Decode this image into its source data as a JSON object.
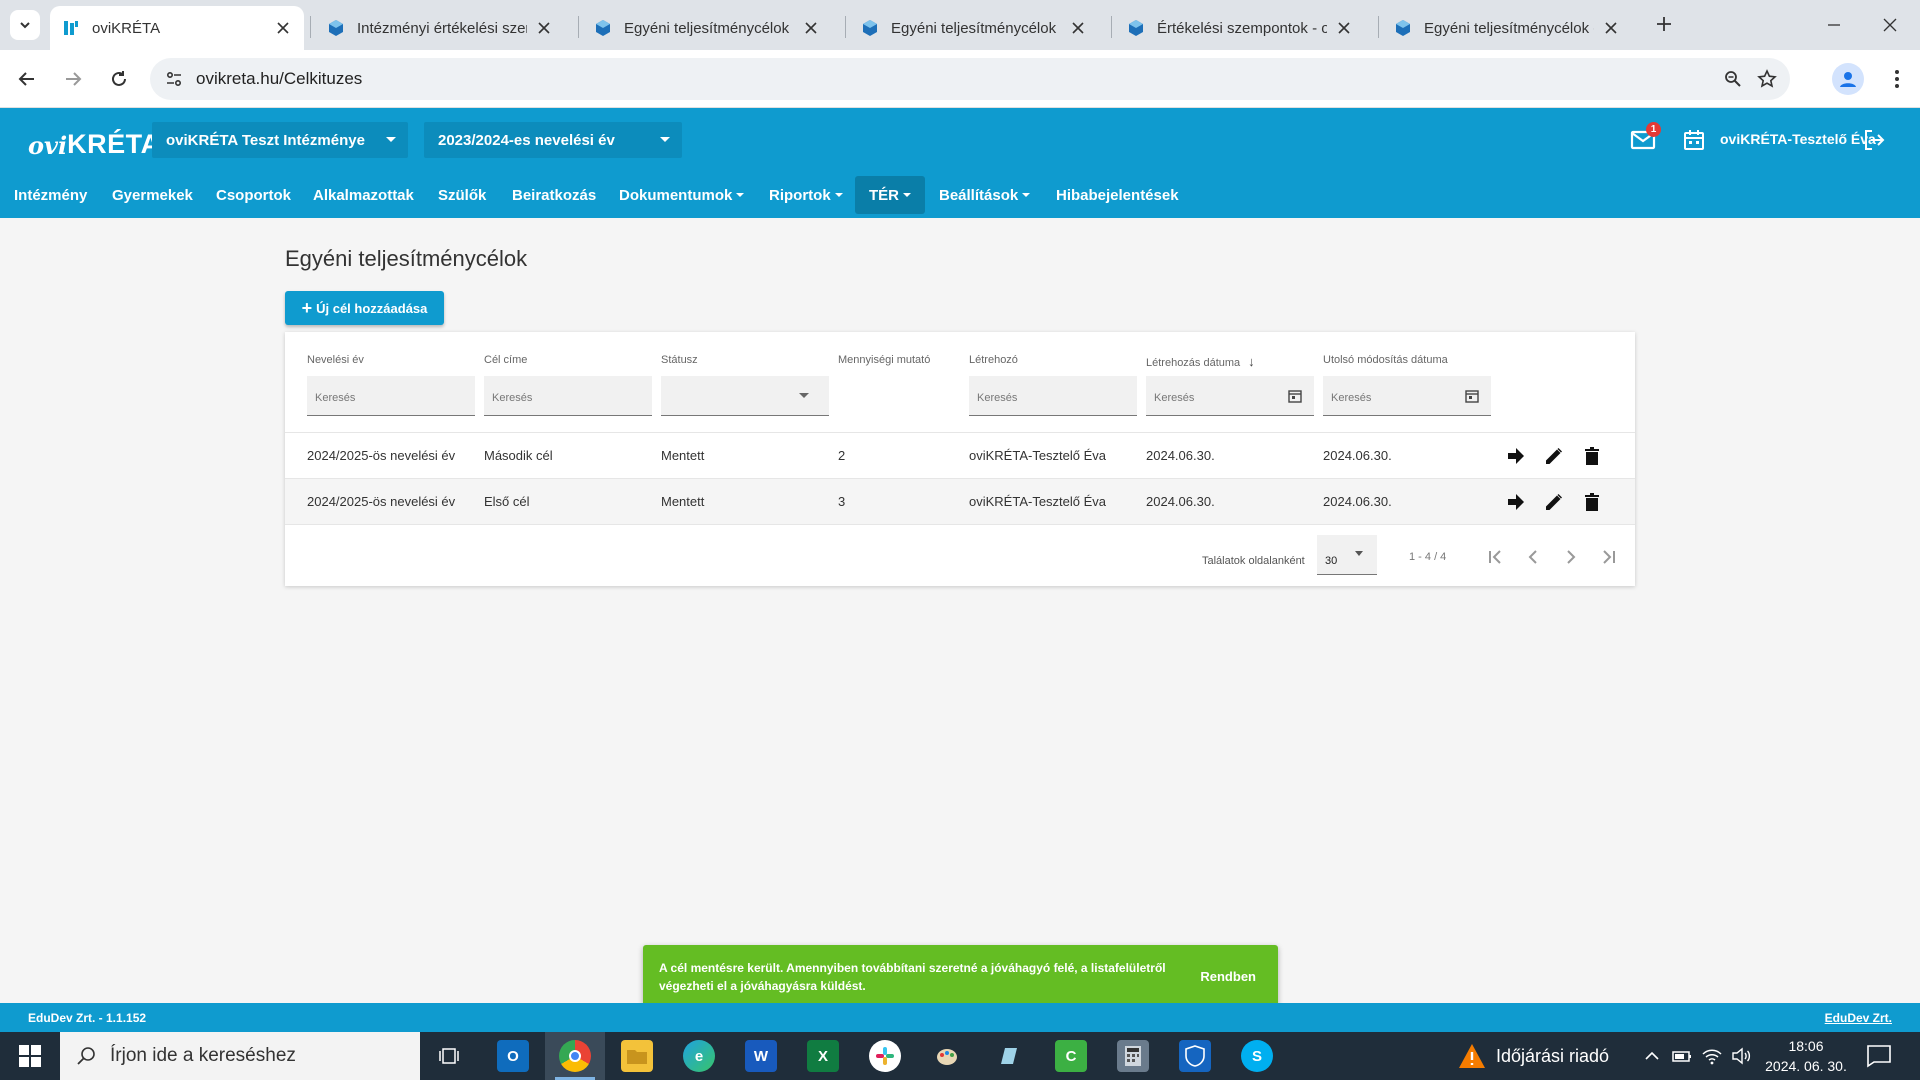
{
  "browser": {
    "tabs": [
      {
        "title": "oviKRÉTA",
        "active": true
      },
      {
        "title": "Intézményi értékelési szem",
        "active": false
      },
      {
        "title": "Egyéni teljesítménycélok r",
        "active": false
      },
      {
        "title": "Egyéni teljesítménycélok r",
        "active": false
      },
      {
        "title": "Értékelési szempontok - ov",
        "active": false
      },
      {
        "title": "Egyéni teljesítménycélok -",
        "active": false
      }
    ],
    "url": "ovikreta.hu/Celkituzes"
  },
  "header": {
    "logo_prefix": "ovi",
    "logo_main": "KRÉTA",
    "institution": "oviKRÉTA Teszt Intézménye",
    "school_year": "2023/2024-es nevelési év",
    "mail_badge": "1",
    "user": "oviKRÉTA-Tesztelő Éva"
  },
  "nav": [
    {
      "label": "Intézmény",
      "dropdown": false
    },
    {
      "label": "Gyermekek",
      "dropdown": false
    },
    {
      "label": "Csoportok",
      "dropdown": false
    },
    {
      "label": "Alkalmazottak",
      "dropdown": false
    },
    {
      "label": "Szülők",
      "dropdown": false
    },
    {
      "label": "Beiratkozás",
      "dropdown": false
    },
    {
      "label": "Dokumentumok",
      "dropdown": true
    },
    {
      "label": "Riportok",
      "dropdown": true
    },
    {
      "label": "TÉR",
      "dropdown": true
    },
    {
      "label": "Beállítások",
      "dropdown": true
    },
    {
      "label": "Hibabejelentések",
      "dropdown": false
    }
  ],
  "page": {
    "title": "Egyéni teljesítménycélok",
    "add_button": "Új cél hozzáadása"
  },
  "grid": {
    "columns": [
      "Nevelési év",
      "Cél címe",
      "Státusz",
      "Mennyiségi mutató",
      "Létrehozó",
      "Létrehozás dátuma",
      "Utolsó módosítás dátuma"
    ],
    "filter_placeholder": "Keresés",
    "rows": [
      [
        "2024/2025-ös nevelési év",
        "Második cél",
        "Mentett",
        "2",
        "oviKRÉTA-Tesztelő Éva",
        "2024.06.30.",
        "2024.06.30."
      ],
      [
        "2024/2025-ös nevelési év",
        "Első cél",
        "Mentett",
        "3",
        "oviKRÉTA-Tesztelő Éva",
        "2024.06.30.",
        "2024.06.30."
      ]
    ],
    "per_page_label": "Találatok oldalanként",
    "per_page": "30",
    "range": "1 - 4 / 4"
  },
  "footer": {
    "version": "EduDev Zrt. - 1.1.152",
    "link": "EduDev Zrt."
  },
  "toast": {
    "message": "A cél mentésre került. Amennyiben továbbítani szeretné a jóváhagyó felé, a listafelületről végezheti el a jóváhagyásra küldést.",
    "button": "Rendben"
  },
  "taskbar": {
    "search_placeholder": "Írjon ide a kereséshez",
    "weather": "Időjárási riadó",
    "time": "18:06",
    "date": "2024. 06. 30."
  },
  "colors": {
    "brand": "#0f9bcf",
    "toast": "#64bd23"
  }
}
